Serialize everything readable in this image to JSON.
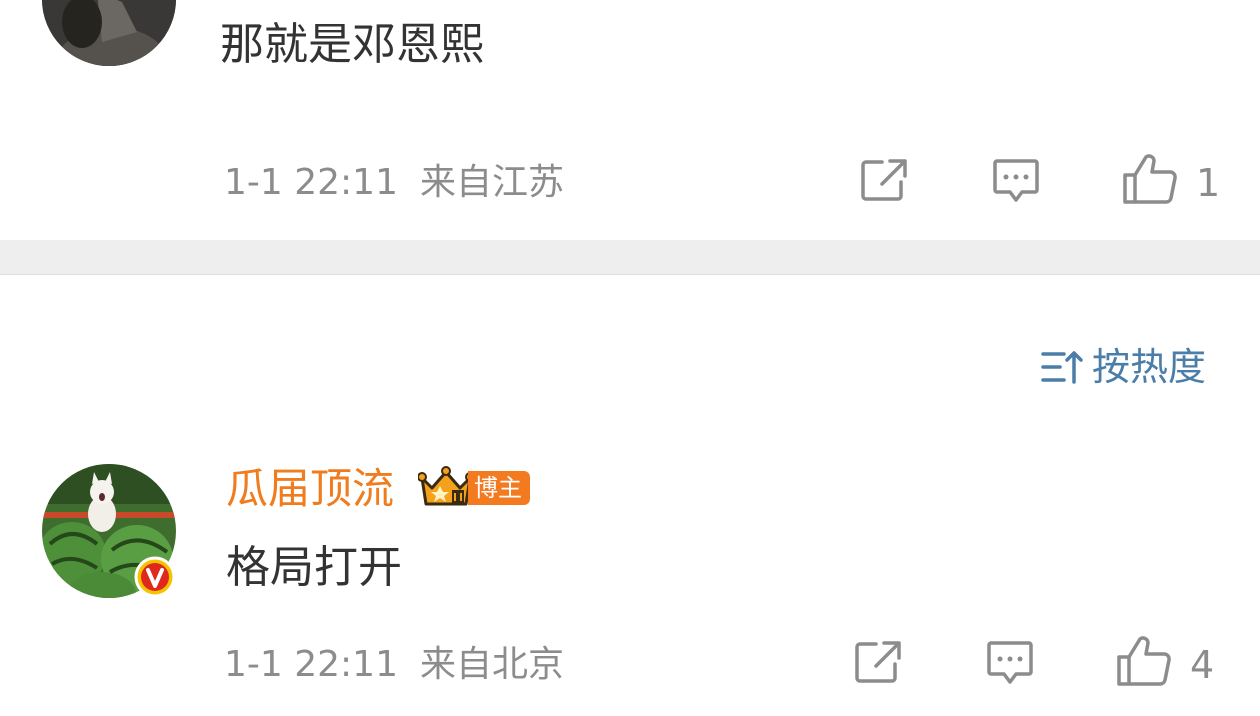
{
  "comment1": {
    "text": "那就是邓恩熙",
    "time": "1-1 22:11",
    "location": "来自江苏",
    "likes": "1",
    "avatar_icon": "user-avatar"
  },
  "sort": {
    "label": "按热度",
    "icon": "sort-icon"
  },
  "comment2": {
    "username": "瓜届顶流",
    "badge": "博主",
    "text": "格局打开",
    "time": "1-1 22:11",
    "location": "来自北京",
    "likes": "4",
    "avatar_icon": "watermelon-cat-avatar",
    "verified_icon": "verified-v-icon"
  },
  "colors": {
    "username": "#f07c1e",
    "sort": "#4a7ea8",
    "meta": "#8c8c8c",
    "separator": "#eeeeee"
  }
}
